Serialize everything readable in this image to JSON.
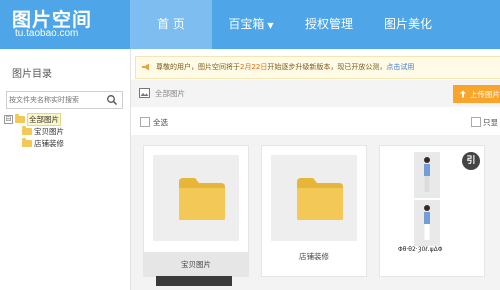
{
  "header": {
    "logo_title": "图片空间",
    "logo_sub": "tu.taobao.com",
    "nav": [
      {
        "label": "首 页",
        "active": true
      },
      {
        "label": "百宝箱",
        "caret": "▼"
      },
      {
        "label": "授权管理"
      },
      {
        "label": "图片美化"
      }
    ]
  },
  "sidebar": {
    "title": "图片目录",
    "search_placeholder": "按文件夹名称实时搜索",
    "tree": {
      "toggle": "⊟",
      "root": "全部图片",
      "children": [
        "宝贝图片",
        "店铺装修"
      ]
    }
  },
  "notice": {
    "pre": "尊敬的用户，图片空间将于",
    "date": "2月22日",
    "post": "开始逐步升级新版本，现已开放公测，",
    "link": "点击试用"
  },
  "toolbar": {
    "breadcrumb": "全部图片",
    "upload_label": "上传图片",
    "upload_icon": "upload-icon"
  },
  "selectbar": {
    "select_all": "全选",
    "only_show": "只显"
  },
  "cards": [
    {
      "label": "宝贝图片"
    },
    {
      "label": "店铺装修"
    },
    {
      "badge": "引",
      "caption": "Φθ·θ2·Ȝ0ℓ.ψΔΦ"
    }
  ],
  "colors": {
    "header_bg": "#4ea6e8",
    "nav_active": "#7dbdf0",
    "upload_btn": "#f9a52b",
    "folder": "#f4c857"
  }
}
